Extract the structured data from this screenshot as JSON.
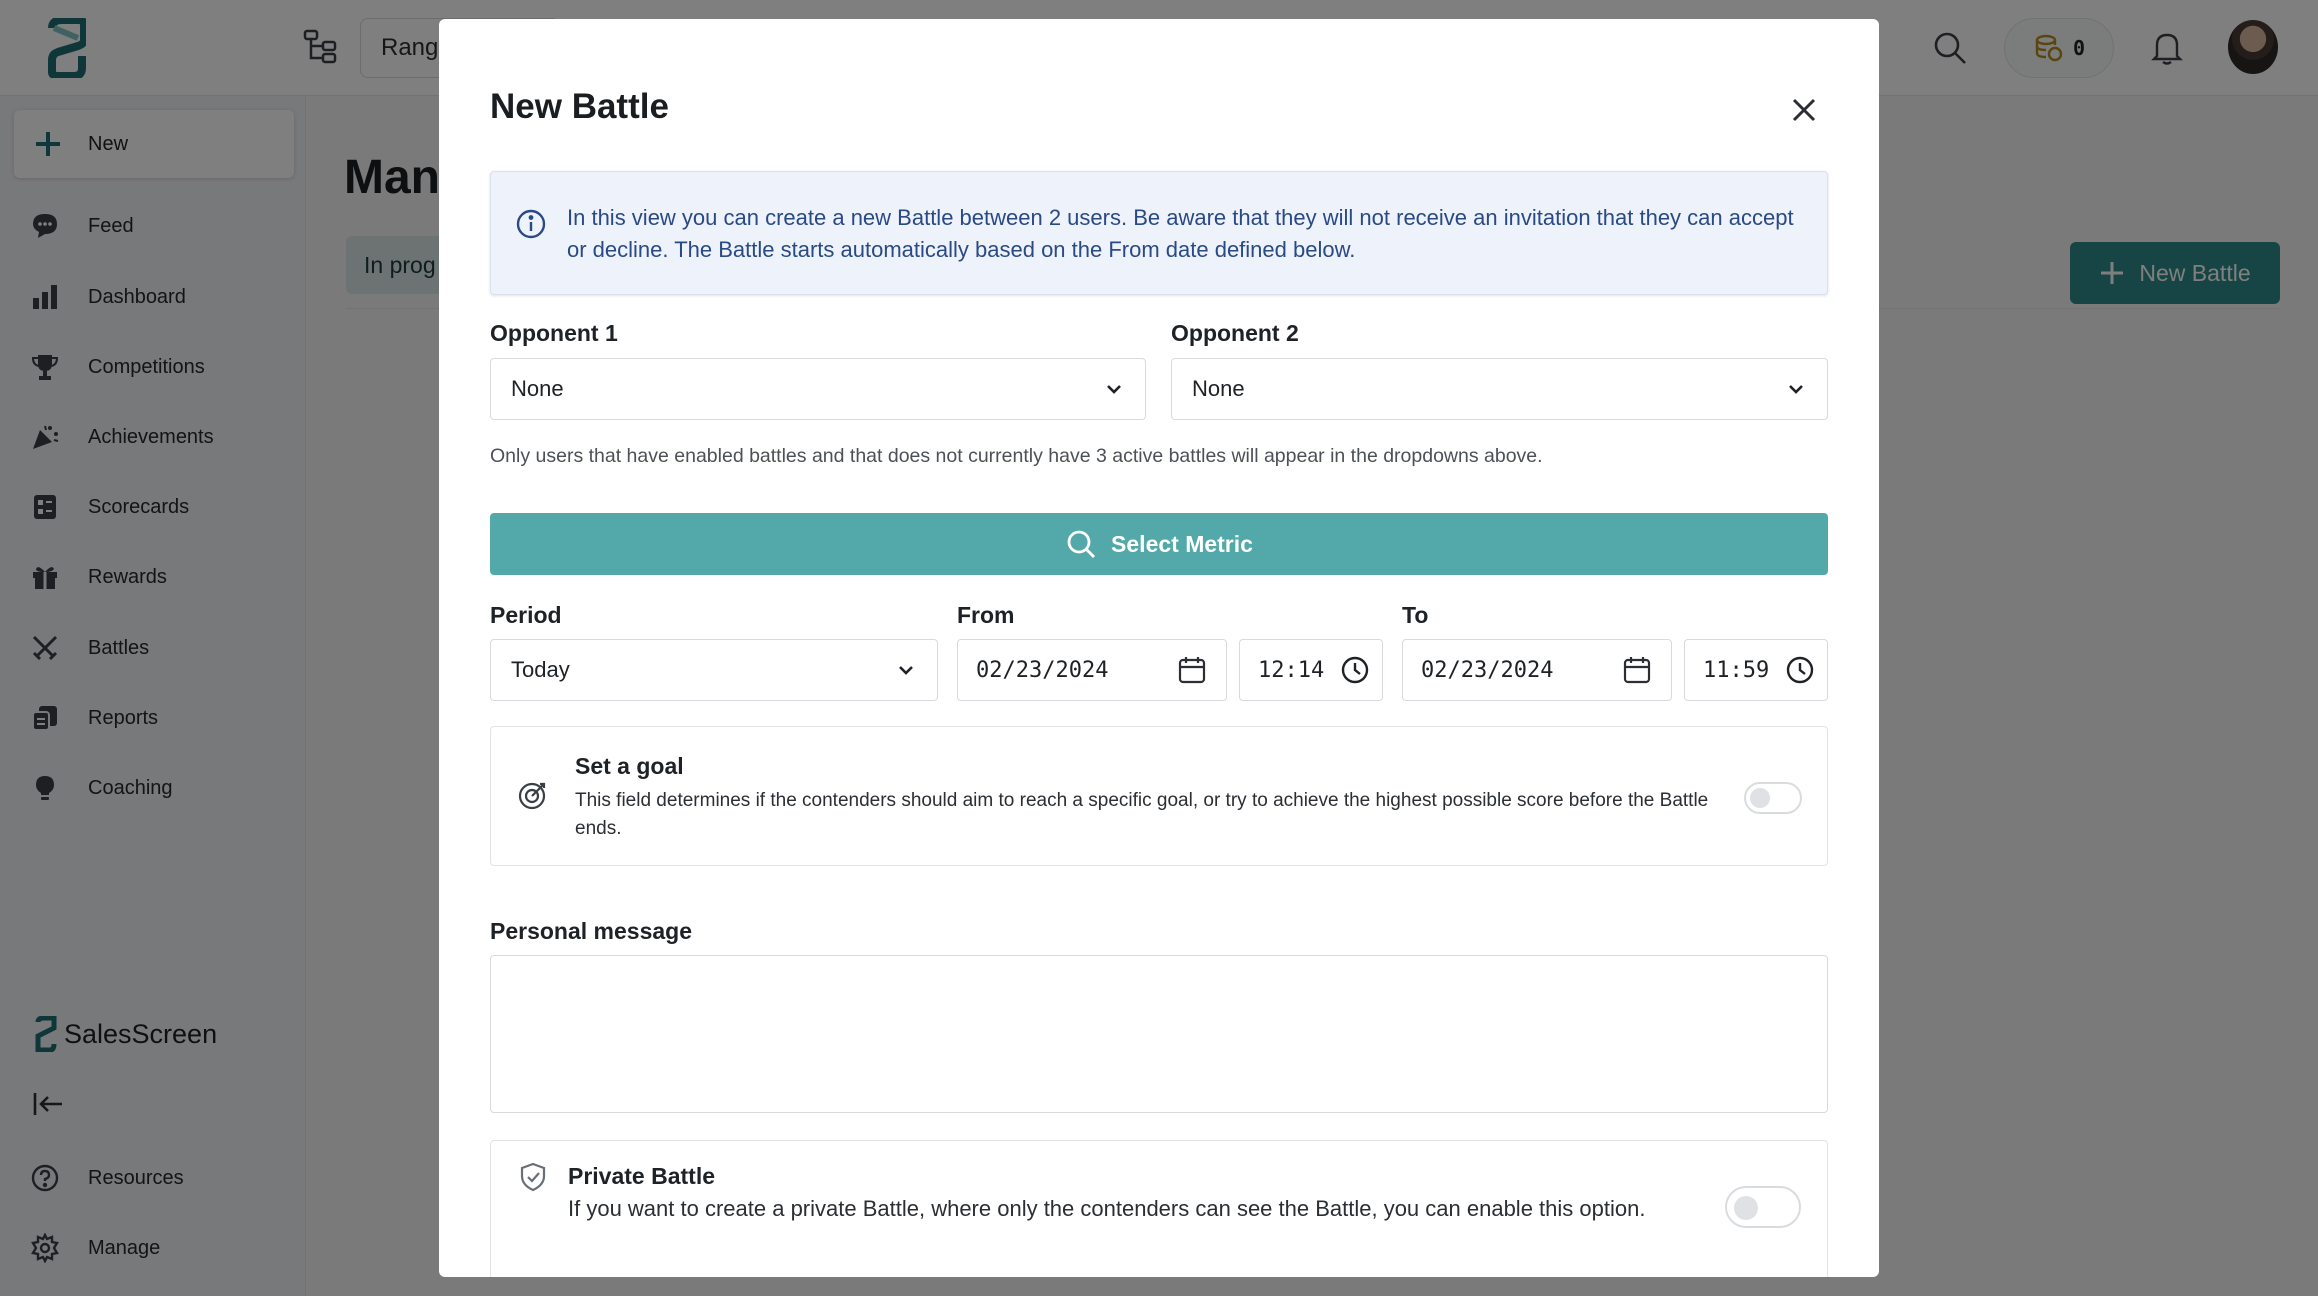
{
  "topbar": {
    "range_label": "Range",
    "coins_count": "0"
  },
  "sidebar": {
    "new_label": "New",
    "items": [
      {
        "label": "Feed"
      },
      {
        "label": "Dashboard"
      },
      {
        "label": "Competitions"
      },
      {
        "label": "Achievements"
      },
      {
        "label": "Scorecards"
      },
      {
        "label": "Rewards"
      },
      {
        "label": "Battles"
      },
      {
        "label": "Reports"
      },
      {
        "label": "Coaching"
      }
    ],
    "brand": "SalesScreen",
    "bottom_items": [
      {
        "label": "Resources"
      },
      {
        "label": "Manage"
      }
    ]
  },
  "main": {
    "title": "Man",
    "tab": "In prog",
    "new_battle_label": "New Battle"
  },
  "modal": {
    "title": "New Battle",
    "info_text": "In this view you can create a new Battle between 2 users. Be aware that they will not receive an invitation that they can accept or decline. The Battle starts automatically based on the From date defined below.",
    "opponent1": {
      "label": "Opponent 1",
      "value": "None"
    },
    "opponent2": {
      "label": "Opponent 2",
      "value": "None"
    },
    "hint": "Only users that have enabled battles and that does not currently have 3 active battles will appear in the dropdowns above.",
    "select_metric_label": "Select Metric",
    "period": {
      "label": "Period",
      "value": "Today"
    },
    "from": {
      "label": "From",
      "date": "02/23/2024",
      "time": "12:14"
    },
    "to": {
      "label": "To",
      "date": "02/23/2024",
      "time": "11:59"
    },
    "goal": {
      "title": "Set a goal",
      "description": "This field determines if the contenders should aim to reach a specific goal, or try to achieve the highest possible score before the Battle ends.",
      "enabled": false
    },
    "personal_message": {
      "label": "Personal message",
      "value": ""
    },
    "private_battle": {
      "title": "Private Battle",
      "description": "If you want to create a private Battle, where only the contenders can see the Battle, you can enable this option.",
      "enabled": false
    }
  },
  "colors": {
    "accent": "#53a8a9",
    "accent_dark": "#2f8a8b",
    "info_bg": "#eef2fb",
    "info_text": "#2a4a86"
  }
}
